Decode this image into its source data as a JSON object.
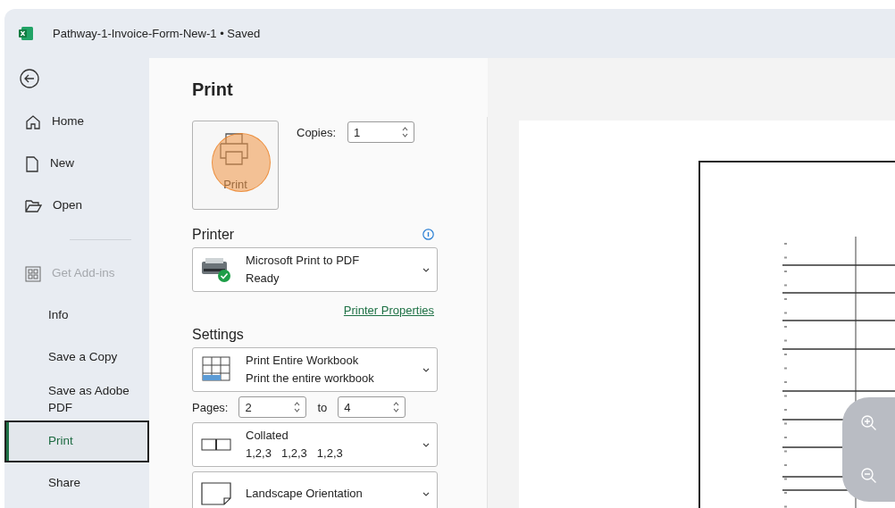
{
  "window": {
    "title": "Pathway-1-Invoice-Form-New-1",
    "separator": "•",
    "status": "Saved"
  },
  "sidebar": {
    "top_items": [
      {
        "label": "Home",
        "kind": "home",
        "selected": false,
        "disabled": false
      },
      {
        "label": "New",
        "kind": "new",
        "selected": false,
        "disabled": false
      },
      {
        "label": "Open",
        "kind": "open",
        "selected": false,
        "disabled": false
      }
    ],
    "items": [
      {
        "label": "Get Add-ins",
        "kind": "addins",
        "selected": false,
        "disabled": true
      },
      {
        "label": "Info",
        "kind": "text",
        "selected": false,
        "disabled": false
      },
      {
        "label": "Save a Copy",
        "kind": "text",
        "selected": false,
        "disabled": false
      },
      {
        "label": "Save as Adobe PDF",
        "kind": "text",
        "selected": false,
        "disabled": false
      },
      {
        "label": "Print",
        "kind": "text",
        "selected": true,
        "disabled": false
      },
      {
        "label": "Share",
        "kind": "text",
        "selected": false,
        "disabled": false
      }
    ]
  },
  "print": {
    "title": "Print",
    "print_button": {
      "label": "Print",
      "pressed": true
    },
    "copies": {
      "label": "Copies:",
      "value": "1"
    },
    "printer": {
      "heading": "Printer",
      "name": "Microsoft Print to PDF",
      "status": "Ready",
      "link": "Printer Properties"
    },
    "settings": {
      "heading": "Settings",
      "items": [
        {
          "kind": "sheets",
          "title": "Print Entire Workbook",
          "detail": "Print the entire workbook"
        },
        {
          "kind": "pages",
          "label": "Pages:",
          "from": "2",
          "to_label": "to",
          "to": "4"
        },
        {
          "kind": "collated",
          "title": "Collated",
          "detail_parts": [
            "1,2,3",
            "1,2,3",
            "1,2,3"
          ]
        },
        {
          "kind": "orientation",
          "title": "Landscape Orientation"
        }
      ]
    }
  }
}
